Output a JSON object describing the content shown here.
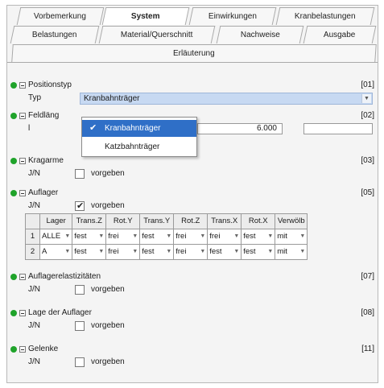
{
  "tabs_row1": [
    "Vorbemerkung",
    "System",
    "Einwirkungen",
    "Kranbelastungen"
  ],
  "tabs_row2": [
    "Belastungen",
    "Material/Querschnitt",
    "Nachweise",
    "Ausgabe"
  ],
  "tabs_row3": [
    "Erläuterung"
  ],
  "active_tab": "System",
  "positionstyp": {
    "title": "Positionstyp",
    "num": "[01]",
    "typ_label": "Typ",
    "typ_value": "Kranbahnträger"
  },
  "dropdown": {
    "options": [
      "Kranbahnträger",
      "Katzbahnträger"
    ],
    "selected": "Kranbahnträger"
  },
  "feldlaenge": {
    "title": "Feldläng",
    "num": "[02]",
    "l_label": "l",
    "l_value": "6.000",
    "extra_value": ""
  },
  "kragarme": {
    "title": "Kragarme",
    "num": "[03]",
    "jn_label": "J/N",
    "cb_label": "vorgeben",
    "checked": false
  },
  "auflager": {
    "title": "Auflager",
    "num": "[05]",
    "jn_label": "J/N",
    "cb_label": "vorgeben",
    "checked": true,
    "columns": [
      "",
      "Lager",
      "Trans.Z",
      "Rot.Y",
      "Trans.Y",
      "Rot.Z",
      "Trans.X",
      "Rot.X",
      "Verwölb"
    ],
    "rows": [
      [
        "1",
        "ALLE",
        "fest",
        "frei",
        "fest",
        "frei",
        "frei",
        "fest",
        "mit"
      ],
      [
        "2",
        "A",
        "fest",
        "frei",
        "fest",
        "frei",
        "fest",
        "fest",
        "mit"
      ]
    ]
  },
  "auflagerelast": {
    "title": "Auflagerelastizitäten",
    "num": "[07]",
    "jn_label": "J/N",
    "cb_label": "vorgeben",
    "checked": false
  },
  "lage": {
    "title": "Lage der Auflager",
    "num": "[08]",
    "jn_label": "J/N",
    "cb_label": "vorgeben",
    "checked": false
  },
  "gelenke": {
    "title": "Gelenke",
    "num": "[11]",
    "jn_label": "J/N",
    "cb_label": "vorgeben",
    "checked": false
  },
  "icons": {
    "section_bullet": "green-dot-icon",
    "collapse": "minus-box-icon",
    "dropdown": "chevron-down-icon",
    "check": "checkmark-icon"
  },
  "colors": {
    "bullet_green": "#1fa32a",
    "selection_blue": "#2f6fc7",
    "field_blue": "#c7d9f2"
  }
}
